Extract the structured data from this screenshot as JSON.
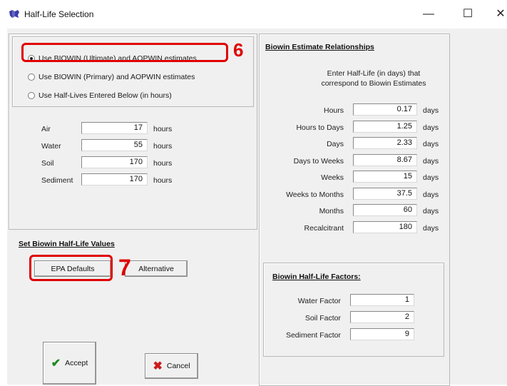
{
  "window": {
    "title": "Half-Life Selection",
    "minimize": "—",
    "maximize": "☐",
    "close": "✕"
  },
  "estimate_options": [
    {
      "label": "Use BIOWIN (Ultimate) and AOPWIN estimates",
      "checked": true
    },
    {
      "label": "Use BIOWIN (Primary) and AOPWIN estimates",
      "checked": false
    },
    {
      "label": "Use Half-Lives Entered Below (in hours)",
      "checked": false
    }
  ],
  "half_lives": [
    {
      "label": "Air",
      "value": "17",
      "unit": "hours"
    },
    {
      "label": "Water",
      "value": "55",
      "unit": "hours"
    },
    {
      "label": "Soil",
      "value": "170",
      "unit": "hours"
    },
    {
      "label": "Sediment",
      "value": "170",
      "unit": "hours"
    }
  ],
  "set_biowin": {
    "heading": "Set Biowin Half-Life Values",
    "epa_defaults": "EPA Defaults",
    "alternative": "Alternative"
  },
  "relationships": {
    "heading": "Biowin Estimate Relationships",
    "description_line1": "Enter Half-Life (in days) that",
    "description_line2": "correspond to Biowin Estimates",
    "rows": [
      {
        "label": "Hours",
        "value": "0.17",
        "unit": "days"
      },
      {
        "label": "Hours to Days",
        "value": "1.25",
        "unit": "days"
      },
      {
        "label": "Days",
        "value": "2.33",
        "unit": "days"
      },
      {
        "label": "Days to Weeks",
        "value": "8.67",
        "unit": "days"
      },
      {
        "label": "Weeks",
        "value": "15",
        "unit": "days"
      },
      {
        "label": "Weeks to Months",
        "value": "37.5",
        "unit": "days"
      },
      {
        "label": "Months",
        "value": "60",
        "unit": "days"
      },
      {
        "label": "Recalcitrant",
        "value": "180",
        "unit": "days"
      }
    ]
  },
  "factors": {
    "heading": "Biowin Half-Life Factors:",
    "rows": [
      {
        "label": "Water Factor",
        "value": "1"
      },
      {
        "label": "Soil Factor",
        "value": "2"
      },
      {
        "label": "Sediment Factor",
        "value": "9"
      }
    ]
  },
  "buttons": {
    "accept": "Accept",
    "cancel": "Cancel"
  },
  "icons": {
    "accept": "checkmark-icon",
    "cancel": "x-mark-icon"
  },
  "annotations": {
    "callout_6": "6",
    "callout_7": "7"
  },
  "colors": {
    "annotation": "#e00000",
    "accept_check": "#1e8a1e",
    "cancel_x": "#cc1b1b"
  }
}
